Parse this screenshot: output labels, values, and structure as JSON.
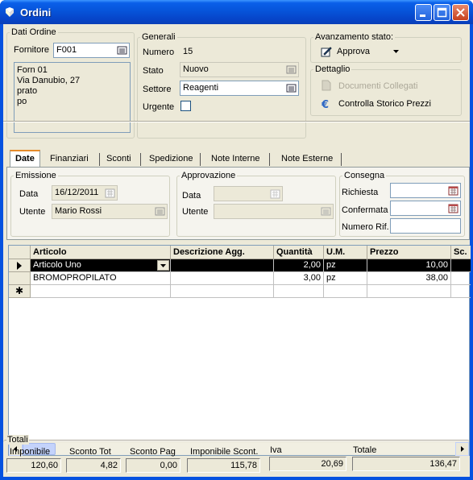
{
  "window": {
    "title": "Ordini"
  },
  "dati_ordine": {
    "group_label": "Dati Ordine",
    "fornitore_label": "Fornitore",
    "fornitore_value": "F001",
    "address_lines": [
      "Forn 01",
      "Via Danubio, 27",
      "prato",
      "po"
    ]
  },
  "generali": {
    "group_label": "Generali",
    "numero_label": "Numero",
    "numero_value": "15",
    "stato_label": "Stato",
    "stato_value": "Nuovo",
    "settore_label": "Settore",
    "settore_value": "Reagenti",
    "urgente_label": "Urgente"
  },
  "avanzamento": {
    "group_label": "Avanzamento stato:",
    "approva_label": "Approva"
  },
  "dettaglio": {
    "group_label": "Dettaglio",
    "documenti_label": "Documenti Collegati",
    "storico_label": "Controlla Storico Prezzi"
  },
  "tabs": [
    {
      "label": "Date",
      "active": true
    },
    {
      "label": "Finanziari"
    },
    {
      "label": "Sconti"
    },
    {
      "label": "Spedizione"
    },
    {
      "label": "Note Interne"
    },
    {
      "label": "Note Esterne"
    }
  ],
  "emissione": {
    "group_label": "Emissione",
    "data_label": "Data",
    "data_value": "16/12/2011",
    "utente_label": "Utente",
    "utente_value": "Mario Rossi"
  },
  "approvazione": {
    "group_label": "Approvazione",
    "data_label": "Data",
    "utente_label": "Utente"
  },
  "consegna": {
    "group_label": "Consegna",
    "richiesta_label": "Richiesta",
    "confermata_label": "Confermata",
    "numero_rif_label": "Numero Rif."
  },
  "grid": {
    "columns": [
      "Articolo",
      "Descrizione Agg.",
      "Quantità",
      "U.M.",
      "Prezzo",
      "Sc."
    ],
    "rows": [
      {
        "articolo": "Articolo Uno",
        "descrizione": "",
        "quantita": "2,00",
        "um": "pz",
        "prezzo": "10,00"
      },
      {
        "articolo": "BROMOPROPILATO",
        "descrizione": "",
        "quantita": "3,00",
        "um": "pz",
        "prezzo": "38,00"
      }
    ],
    "new_row_marker": "✱"
  },
  "totali": {
    "group_label": "Totali",
    "labels": [
      "Imponibile",
      "Sconto Tot",
      "Sconto Pag",
      "Imponibile Scont.",
      "Iva",
      "Totale"
    ],
    "values": [
      "120,60",
      "4,82",
      "0,00",
      "115,78",
      "20,69",
      "136,47"
    ]
  }
}
